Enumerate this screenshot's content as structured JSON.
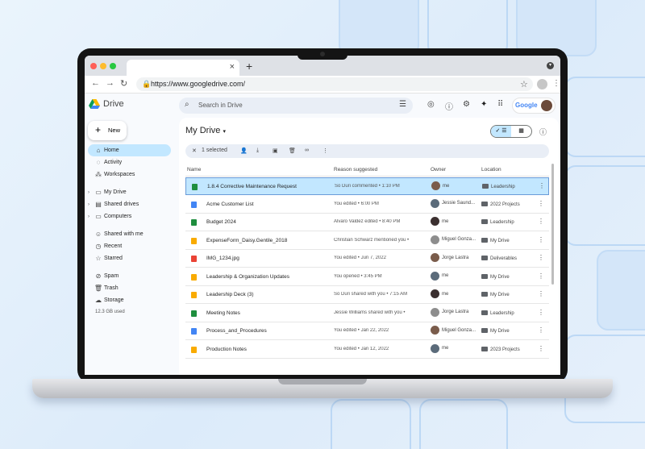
{
  "browser": {
    "url": "https://www.googledrive.com/",
    "new_tab_symbol": "+",
    "close_tab_symbol": "×"
  },
  "app": {
    "name": "Drive",
    "search_placeholder": "Search in Drive",
    "google_label": "Google"
  },
  "sidebar": {
    "new_label": "New",
    "items": [
      {
        "label": "Home",
        "icon": "home-icon",
        "active": true
      },
      {
        "label": "Activity",
        "icon": "activity-icon"
      },
      {
        "label": "Workspaces",
        "icon": "workspaces-icon"
      },
      {
        "label": "My Drive",
        "icon": "my-drive-icon"
      },
      {
        "label": "Shared drives",
        "icon": "shared-drives-icon"
      },
      {
        "label": "Computers",
        "icon": "computers-icon"
      },
      {
        "label": "Shared with me",
        "icon": "shared-with-me-icon"
      },
      {
        "label": "Recent",
        "icon": "clock-icon"
      },
      {
        "label": "Starred",
        "icon": "star-icon"
      },
      {
        "label": "Spam",
        "icon": "spam-icon"
      },
      {
        "label": "Trash",
        "icon": "trash-icon"
      },
      {
        "label": "Storage",
        "icon": "cloud-icon"
      }
    ],
    "storage_used": "12.3 GB used"
  },
  "main": {
    "title": "My Drive",
    "selection": "1 selected",
    "columns": {
      "name": "Name",
      "reason": "Reason suggested",
      "owner": "Owner",
      "location": "Location"
    },
    "files": [
      {
        "name": "1.8.4 Corrective Maintenance Request",
        "type": "sheet",
        "reason": "So Duri commented • 1:10 PM",
        "owner": "me",
        "location": "Leadership",
        "selected": true
      },
      {
        "name": "Acme Customer List",
        "type": "doc",
        "reason": "You edited • 6:00 PM",
        "owner": "Jessie Saund...",
        "location": "2022 Projects"
      },
      {
        "name": "Budget 2024",
        "type": "sheet",
        "reason": "Alvaro Valdez edited • 8:40 PM",
        "owner": "me",
        "location": "Leadership"
      },
      {
        "name": "ExpenseForm_Daisy.Gentile_2018",
        "type": "slide",
        "reason": "Christian Schwarz mentioned you •",
        "owner": "Miguel Gonza...",
        "location": "My Drive"
      },
      {
        "name": "IMG_1234.jpg",
        "type": "image",
        "reason": "You edited • Jun 7, 2022",
        "owner": "Jorge Lastra",
        "location": "Deliverables"
      },
      {
        "name": "Leadership & Organization Updates",
        "type": "slide",
        "reason": "You opened • 3:45 PM",
        "owner": "me",
        "location": "My Drive"
      },
      {
        "name": "Leadership Deck (3)",
        "type": "slide",
        "reason": "So Duri shared with you • 7:15 AM",
        "owner": "me",
        "location": "My Drive"
      },
      {
        "name": "Meeting Notes",
        "type": "sheet",
        "reason": "Jessie Williams shared with you •",
        "owner": "Jorge Lastra",
        "location": "Leadership"
      },
      {
        "name": "Process_and_Procedures",
        "type": "doc",
        "reason": "You edited • Jan 22, 2022",
        "owner": "Miguel Gonza...",
        "location": "My Drive"
      },
      {
        "name": "Production Notes",
        "type": "slide",
        "reason": "You edited • Jan 12, 2022",
        "owner": "me",
        "location": "2023 Projects"
      }
    ]
  },
  "colors": {
    "sheet": "#1e8e3e",
    "doc": "#4285f4",
    "slide": "#f9ab00",
    "image": "#ea4335",
    "accent": "#c2e7ff"
  }
}
